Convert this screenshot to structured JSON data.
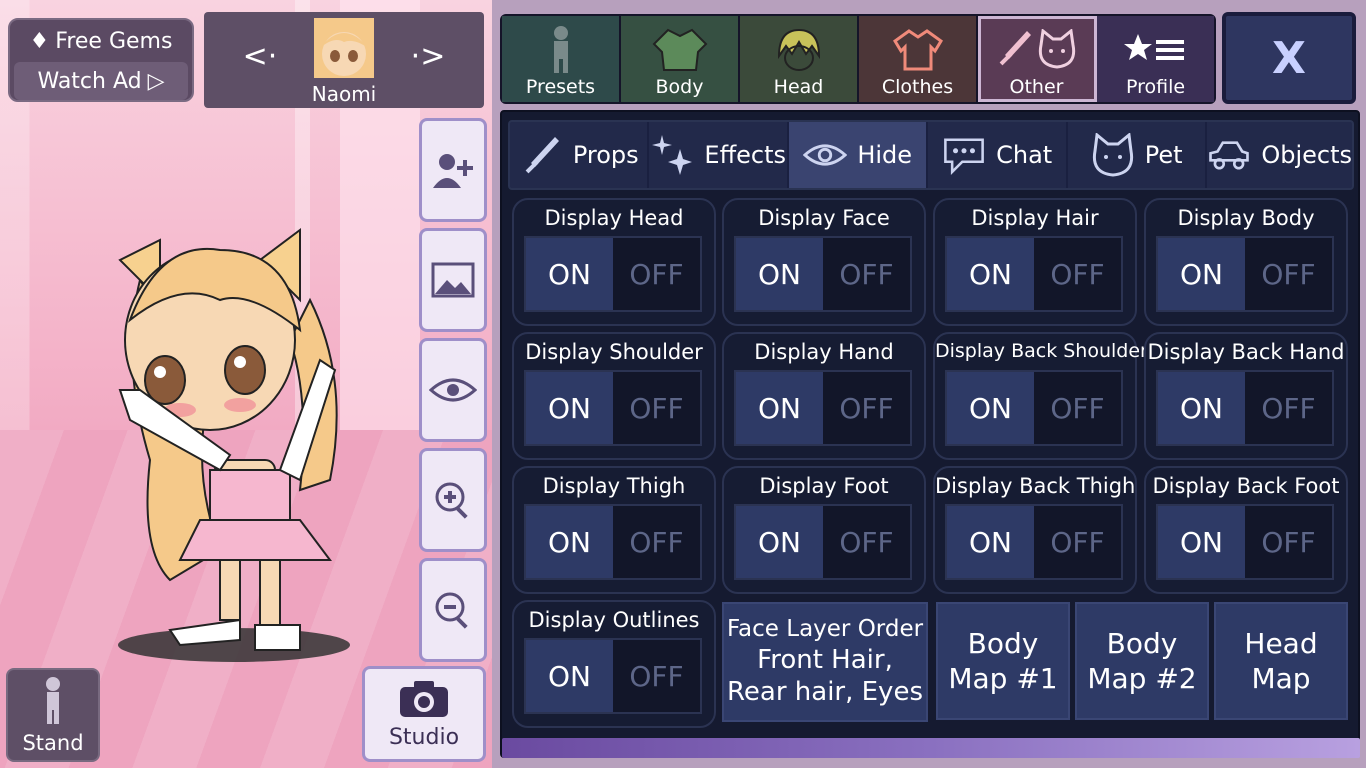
{
  "gems": {
    "free_label": "Free Gems",
    "ad_label": "Watch Ad"
  },
  "character": {
    "name": "Naomi"
  },
  "side_buttons": [
    "add-character",
    "background",
    "hide",
    "zoom-in",
    "zoom-out"
  ],
  "stand": {
    "label": "Stand"
  },
  "studio": {
    "label": "Studio"
  },
  "categories": [
    {
      "label": "Presets"
    },
    {
      "label": "Body"
    },
    {
      "label": "Head"
    },
    {
      "label": "Clothes"
    },
    {
      "label": "Other"
    },
    {
      "label": "Profile"
    }
  ],
  "close": {
    "label": "X"
  },
  "tabs": [
    {
      "label": "Props"
    },
    {
      "label": "Effects"
    },
    {
      "label": "Hide"
    },
    {
      "label": "Chat"
    },
    {
      "label": "Pet"
    },
    {
      "label": "Objects"
    }
  ],
  "toggles": [
    {
      "label": "Display Head",
      "on": "ON",
      "off": "OFF"
    },
    {
      "label": "Display Face",
      "on": "ON",
      "off": "OFF"
    },
    {
      "label": "Display Hair",
      "on": "ON",
      "off": "OFF"
    },
    {
      "label": "Display Body",
      "on": "ON",
      "off": "OFF"
    },
    {
      "label": "Display Shoulder",
      "on": "ON",
      "off": "OFF"
    },
    {
      "label": "Display Hand",
      "on": "ON",
      "off": "OFF"
    },
    {
      "label": "Display Back Shoulder",
      "on": "ON",
      "off": "OFF"
    },
    {
      "label": "Display Back Hand",
      "on": "ON",
      "off": "OFF"
    },
    {
      "label": "Display Thigh",
      "on": "ON",
      "off": "OFF"
    },
    {
      "label": "Display Foot",
      "on": "ON",
      "off": "OFF"
    },
    {
      "label": "Display Back Thigh",
      "on": "ON",
      "off": "OFF"
    },
    {
      "label": "Display Back Foot",
      "on": "ON",
      "off": "OFF"
    },
    {
      "label": "Display Outlines",
      "on": "ON",
      "off": "OFF"
    }
  ],
  "face_layer": {
    "title": "Face Layer Order",
    "line1": "Front Hair,",
    "line2": "Rear hair, Eyes"
  },
  "maps": [
    {
      "line1": "Body",
      "line2": "Map #1"
    },
    {
      "line1": "Body",
      "line2": "Map #2"
    },
    {
      "line1": "Head",
      "line2": "Map"
    }
  ],
  "colors": {
    "accent": "#2e3a66",
    "panel_bg": "#151a30",
    "off_text": "#5d6688"
  }
}
